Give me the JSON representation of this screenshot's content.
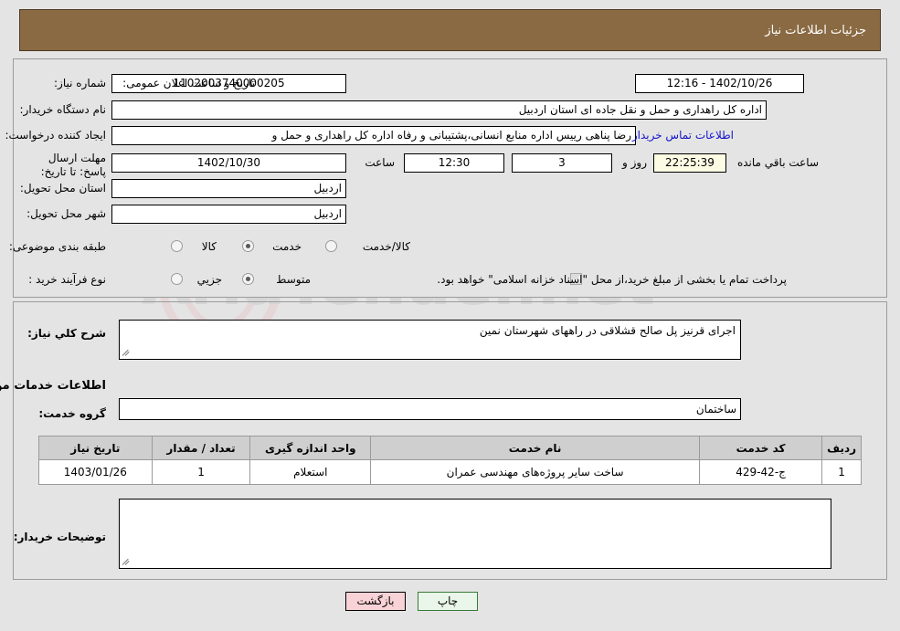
{
  "header": {
    "title": "جزئیات اطلاعات نیاز"
  },
  "top": {
    "need_number_label": "شماره نیاز:",
    "need_number_value": "1102003740000205",
    "public_announce_label": "تاریخ و ساعت اعلان عمومی:",
    "public_announce_value": "1402/10/26 - 12:16",
    "buyer_org_label": "نام دستگاه خریدار:",
    "buyer_org_value": "اداره کل راهداری و حمل و نقل جاده ای استان اردبیل",
    "requester_label": "ایجاد کننده درخواست:",
    "requester_value": "رضا پناهی رییس اداره منابع انسانی،پشتیبانی و رفاه اداره کل راهداری و حمل و",
    "contact_link": "اطلاعات تماس خریدار",
    "deadline_label": "مهلت ارسال پاسخ: تا تاریخ:",
    "deadline_date": "1402/10/30",
    "hour_label": "ساعت",
    "deadline_time": "12:30",
    "days_value": "3",
    "days_label": "روز و",
    "timer_value": "22:25:39",
    "remaining_label": "ساعت باقي مانده",
    "province_label": "استان محل تحویل:",
    "province_value": "اردبیل",
    "city_label": "شهر محل تحویل:",
    "city_value": "اردبیل",
    "category_label": "طبقه بندی موضوعی:",
    "category_options": [
      {
        "label": "کالا",
        "selected": false
      },
      {
        "label": "خدمت",
        "selected": true
      },
      {
        "label": "کالا/خدمت",
        "selected": false
      }
    ],
    "process_label": "نوع فرآیند خرید :",
    "process_options": [
      {
        "label": "جزیي",
        "selected": false
      },
      {
        "label": "متوسط",
        "selected": true
      }
    ],
    "treasury_checkbox_checked": true,
    "treasury_text": "پرداخت تمام یا بخشی از مبلغ خرید،از محل \"اسناد خزانه اسلامی\" خواهد بود."
  },
  "mid": {
    "general_desc_label": "شرح کلي نياز:",
    "general_desc_value": "اجرای قرنیز پل صالح قشلاقی در راههای شهرستان نمین",
    "services_section_title": "اطلاعات خدمات مورد نیاز",
    "service_group_label": "گروه خدمت:",
    "service_group_value": "ساختمان",
    "buyer_notes_label": "توضیحات خریدار:",
    "buyer_notes_value": ""
  },
  "table": {
    "headers": [
      "ردیف",
      "کد خدمت",
      "نام خدمت",
      "واحد اندازه گیری",
      "تعداد / مقدار",
      "تاریخ نیاز"
    ],
    "rows": [
      {
        "radif": "1",
        "code": "ج-42-429",
        "name": "ساخت سایر پروژه‌های مهندسی عمران",
        "unit": "استعلام",
        "qty": "1",
        "date": "1403/01/26"
      }
    ]
  },
  "footer": {
    "print_label": "چاپ",
    "return_label": "بازگشت"
  },
  "watermark": {
    "text": "AriaTender.net"
  },
  "colors": {
    "header_bg": "#8a6a43",
    "page_bg": "#e4e4e4",
    "link": "#1414cc",
    "timer_bg": "#fcfbe4",
    "print_bg": "#e9f6e9",
    "return_bg": "#f8d2d6"
  }
}
